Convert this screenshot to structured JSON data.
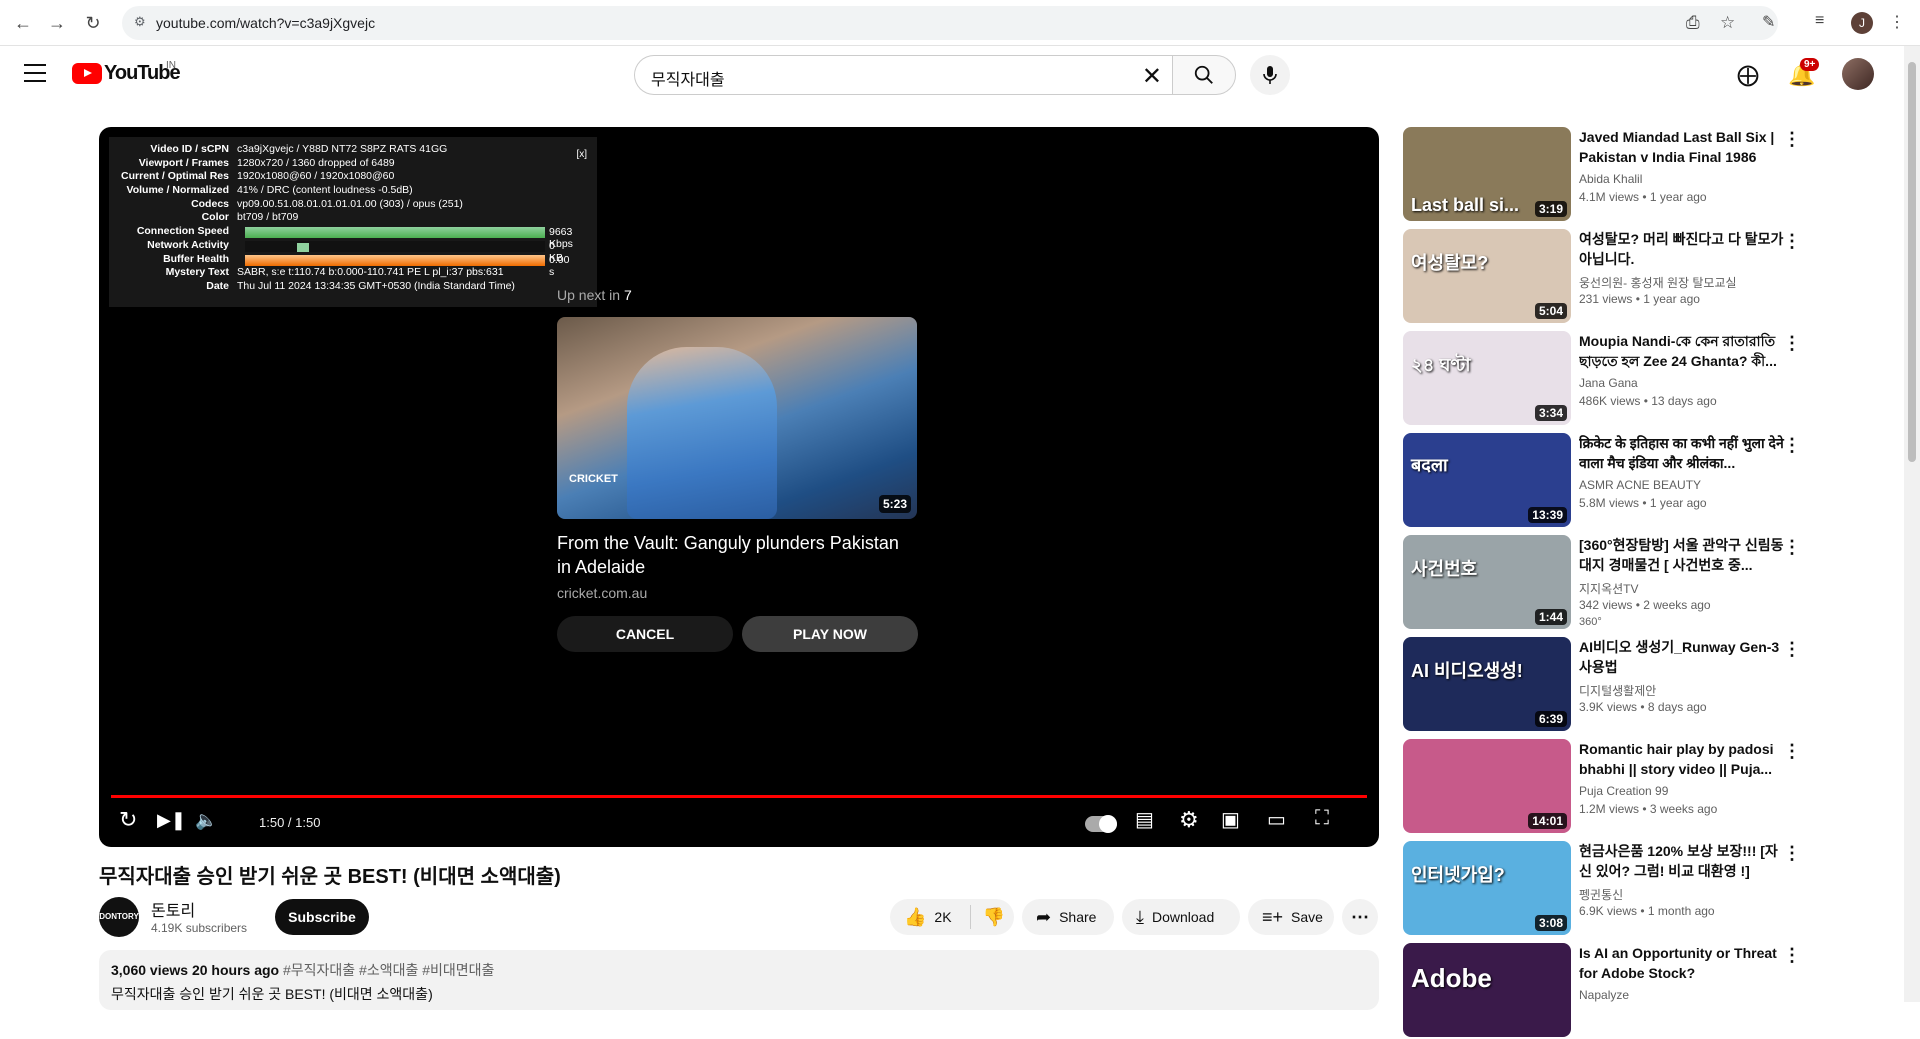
{
  "browser": {
    "url": "youtube.com/watch?v=c3a9jXgvejc",
    "profile_initial": "J"
  },
  "header": {
    "logo_text": "YouTube",
    "country": "IN",
    "search_query": "무직자대출",
    "notif_badge": "9+"
  },
  "player": {
    "stats": [
      {
        "k": "Video ID / sCPN",
        "v": "c3a9jXgvejc / Y88D NT72 S8PZ RATS 41GG"
      },
      {
        "k": "Viewport / Frames",
        "v": "1280x720 / 1360 dropped of 6489"
      },
      {
        "k": "Current / Optimal Res",
        "v": "1920x1080@60 / 1920x1080@60"
      },
      {
        "k": "Volume / Normalized",
        "v": "41% / DRC (content loudness -0.5dB)"
      },
      {
        "k": "Codecs",
        "v": "vp09.00.51.08.01.01.01.01.00 (303) / opus (251)"
      },
      {
        "k": "Color",
        "v": "bt709 / bt709"
      },
      {
        "k": "Connection Speed",
        "v": ""
      },
      {
        "k": "Network Activity",
        "v": ""
      },
      {
        "k": "Buffer Health",
        "v": ""
      },
      {
        "k": "Mystery Text",
        "v": "SABR, s:e t:110.74 b:0.000-110.741 PE L pl_i:37 pbs:631"
      },
      {
        "k": "Date",
        "v": "Thu Jul 11 2024 13:34:35 GMT+0530 (India Standard Time)"
      }
    ],
    "stats_close": "[x]",
    "connection_speed": "9663 Kbps",
    "network_activity": "0 KB",
    "buffer_health": "0.00 s",
    "upnext_label": "Up next in",
    "upnext_count": "7",
    "upnext_title": "From the Vault: Ganguly plunders Pakistan in Adelaide",
    "upnext_channel": "cricket.com.au",
    "upnext_duration": "5:23",
    "upnext_thumb_text": "CRICKET",
    "cancel_label": "CANCEL",
    "play_now_label": "PLAY NOW",
    "time": "1:50 / 1:50",
    "progress": 1.0
  },
  "video": {
    "title": "무직자대출 승인 받기 쉬운 곳 BEST! (비대면 소액대출)",
    "channel": "돈토리",
    "channel_avatar_text": "DONTORY",
    "subscribers": "4.19K subscribers",
    "subscribe_label": "Subscribe",
    "likes": "2K",
    "share_label": "Share",
    "download_label": "Download",
    "save_label": "Save",
    "views_time": "3,060 views  20 hours ago",
    "hashtags": "#무직자대출 #소액대출 #비대면대출",
    "desc_line": "무직자대출 승인 받기 쉬운 곳 BEST! (비대면 소액대출)"
  },
  "recommendations": [
    {
      "title": "Javed Miandad Last Ball Six | Pakistan v India Final 1986",
      "channel": "Abida Khalil",
      "meta": "4.1M views  •  1 year ago",
      "duration": "3:19",
      "caption": "Last ball si...",
      "bg": "#8a7a5a"
    },
    {
      "title": "여성탈모? 머리 빠진다고 다 탈모가 아닙니다.",
      "channel": "웅선의원- 홍성재 원장 탈모교실",
      "meta": "231 views  •  1 year ago",
      "duration": "5:04",
      "caption": "여성탈모?",
      "bg": "#d9c7b5"
    },
    {
      "title": "Moupia Nandi-কে কেন রাতারাতি ছাড়তে হল Zee 24 Ghanta? কী...",
      "channel": "Jana Gana",
      "meta": "486K views  •  13 days ago",
      "duration": "3:34",
      "caption": "২৪ ঘণ্টা",
      "bg": "#e8e0e8"
    },
    {
      "title": "क्रिकेट के इतिहास का कभी नहीं भुला देने वाला मैच इंडिया और श्रीलंका...",
      "channel": "ASMR ACNE BEAUTY",
      "meta": "5.8M views  •  1 year ago",
      "duration": "13:39",
      "caption": "बदला",
      "bg": "#2b3f8f"
    },
    {
      "title": "[360°현장탐방] 서울 관악구 신림동 대지 경매물건 [ 사건번호 중...",
      "channel": "지지옥션TV",
      "meta": "342 views  •  2 weeks ago",
      "duration": "1:44",
      "caption": "사건번호",
      "bg": "#9aa4a8",
      "extra": "360°"
    },
    {
      "title": "AI비디오 생성기_Runway Gen-3 사용법",
      "channel": "디지털생활제안",
      "meta": "3.9K views  •  8 days ago",
      "duration": "6:39",
      "caption": "AI 비디오생성!",
      "bg": "#1e2a5a"
    },
    {
      "title": "Romantic hair play by padosi bhabhi || story video || Puja...",
      "channel": "Puja Creation 99",
      "meta": "1.2M views  •  3 weeks ago",
      "duration": "14:01",
      "caption": "",
      "bg": "#c75a8a"
    },
    {
      "title": "현금사은품 120% 보상 보장!!! [자신 있어? 그럼! 비교 대환영 !]",
      "channel": "펭귄통신",
      "meta": "6.9K views  •  1 month ago",
      "duration": "3:08",
      "caption": "인터넷가입?",
      "bg": "#5ab0e0"
    },
    {
      "title": "Is AI an Opportunity or Threat for Adobe Stock?",
      "channel": "Napalyze",
      "meta": "",
      "duration": "",
      "caption": "Adobe",
      "bg": "#3a1a4a"
    }
  ]
}
